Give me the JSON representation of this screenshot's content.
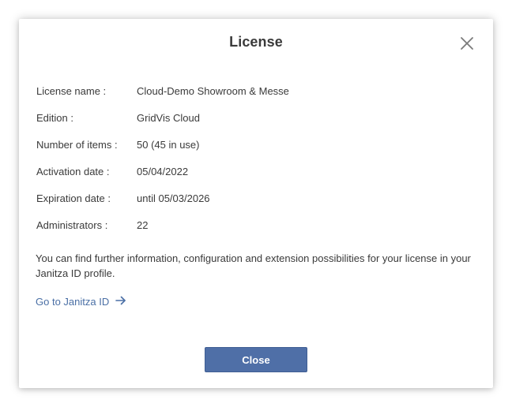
{
  "dialog": {
    "title": "License",
    "close_icon": "close-icon"
  },
  "license": {
    "rows": [
      {
        "label": "License name :",
        "value": "Cloud-Demo Showroom & Messe"
      },
      {
        "label": "Edition :",
        "value": "GridVis Cloud"
      },
      {
        "label": "Number of items :",
        "value": "50 (45 in use)"
      },
      {
        "label": "Activation date :",
        "value": "05/04/2022"
      },
      {
        "label": "Expiration date :",
        "value": "until 05/03/2026"
      },
      {
        "label": "Administrators :",
        "value": "22"
      }
    ]
  },
  "note": "You can find further information, configuration and extension possibilities for your license in your Janitza ID profile.",
  "link": {
    "label": "Go to Janitza ID",
    "icon": "arrow-right-icon",
    "color": "#4a6fa5"
  },
  "footer": {
    "close_label": "Close",
    "button_color": "#4f6fa7"
  }
}
